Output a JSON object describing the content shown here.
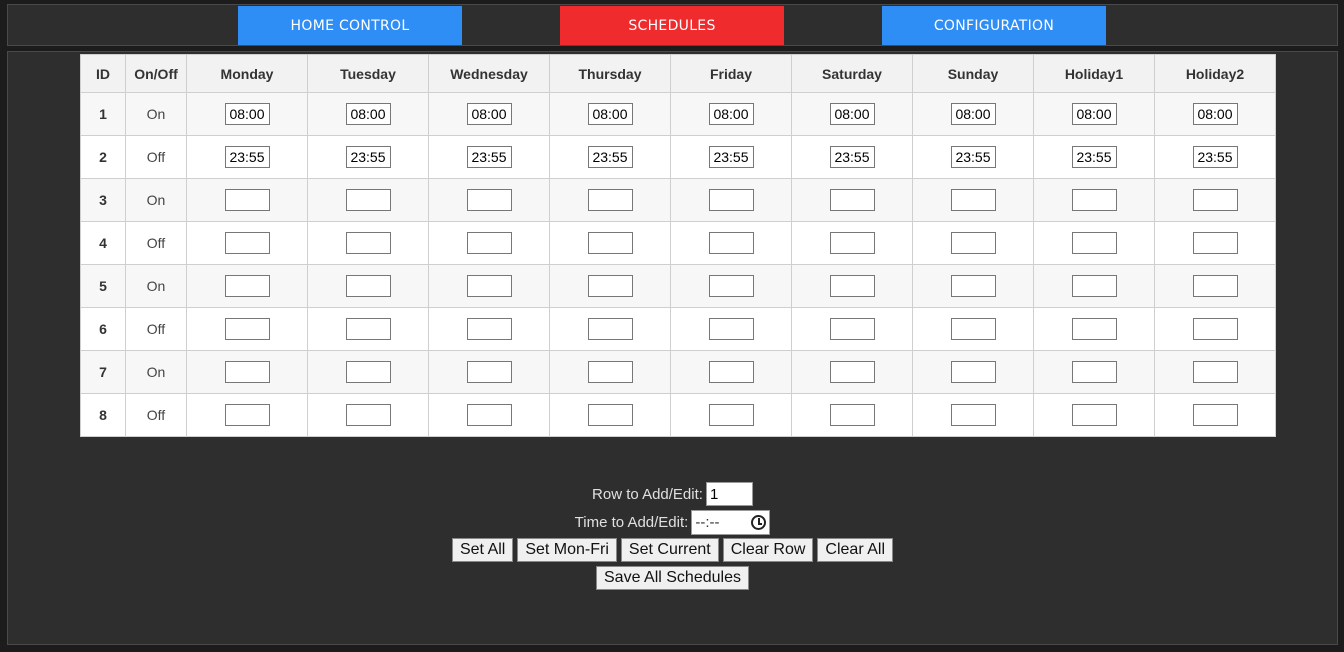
{
  "nav": {
    "home": "HOME CONTROL",
    "schedules": "SCHEDULES",
    "configuration": "CONFIGURATION"
  },
  "table": {
    "columns": [
      "ID",
      "On/Off",
      "Monday",
      "Tuesday",
      "Wednesday",
      "Thursday",
      "Friday",
      "Saturday",
      "Sunday",
      "Holiday1",
      "Holiday2"
    ],
    "rows": [
      {
        "id": "1",
        "state": "On",
        "times": [
          "08:00",
          "08:00",
          "08:00",
          "08:00",
          "08:00",
          "08:00",
          "08:00",
          "08:00",
          "08:00"
        ]
      },
      {
        "id": "2",
        "state": "Off",
        "times": [
          "23:55",
          "23:55",
          "23:55",
          "23:55",
          "23:55",
          "23:55",
          "23:55",
          "23:55",
          "23:55"
        ]
      },
      {
        "id": "3",
        "state": "On",
        "times": [
          "",
          "",
          "",
          "",
          "",
          "",
          "",
          "",
          ""
        ]
      },
      {
        "id": "4",
        "state": "Off",
        "times": [
          "",
          "",
          "",
          "",
          "",
          "",
          "",
          "",
          ""
        ]
      },
      {
        "id": "5",
        "state": "On",
        "times": [
          "",
          "",
          "",
          "",
          "",
          "",
          "",
          "",
          ""
        ]
      },
      {
        "id": "6",
        "state": "Off",
        "times": [
          "",
          "",
          "",
          "",
          "",
          "",
          "",
          "",
          ""
        ]
      },
      {
        "id": "7",
        "state": "On",
        "times": [
          "",
          "",
          "",
          "",
          "",
          "",
          "",
          "",
          ""
        ]
      },
      {
        "id": "8",
        "state": "Off",
        "times": [
          "",
          "",
          "",
          "",
          "",
          "",
          "",
          "",
          ""
        ]
      }
    ]
  },
  "controls": {
    "row_label": "Row to Add/Edit:",
    "row_value": "1",
    "time_label": "Time to Add/Edit:",
    "time_placeholder": "--:--",
    "buttons": {
      "set_all": "Set All",
      "set_mon_fri": "Set Mon-Fri",
      "set_current": "Set Current",
      "clear_row": "Clear Row",
      "clear_all": "Clear All",
      "save_all": "Save All Schedules"
    }
  }
}
